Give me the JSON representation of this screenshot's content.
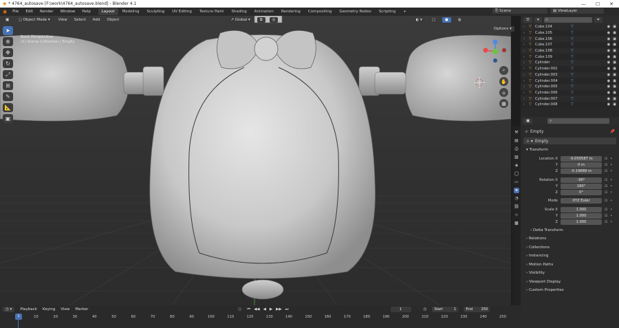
{
  "window": {
    "title": "* 4764_autosave [F:\\work\\4764_autosave.blend] - Blender 4.1",
    "controls": [
      "—",
      "☐",
      "✕"
    ]
  },
  "menus": [
    "File",
    "Edit",
    "Render",
    "Window",
    "Help"
  ],
  "workspaces": [
    {
      "label": "Layout",
      "active": true
    },
    {
      "label": "Modeling"
    },
    {
      "label": "Sculpting"
    },
    {
      "label": "UV Editing"
    },
    {
      "label": "Texture Paint"
    },
    {
      "label": "Shading"
    },
    {
      "label": "Animation"
    },
    {
      "label": "Rendering"
    },
    {
      "label": "Compositing"
    },
    {
      "label": "Geometry Nodes"
    },
    {
      "label": "Scripting"
    },
    {
      "label": "+"
    }
  ],
  "scene": {
    "label": "Scene",
    "viewlayer": "ViewLayer"
  },
  "viewport": {
    "mode": "Object Mode",
    "menus": [
      "View",
      "Select",
      "Add",
      "Object"
    ],
    "orientation": "Global",
    "options_label": "Options",
    "info_line1": "Back Perspective",
    "info_line2": "(1) Scene Collection | Empty"
  },
  "outliner": {
    "search_placeholder": "",
    "items": [
      "Cube.104",
      "Cube.105",
      "Cube.106",
      "Cube.107",
      "Cube.108",
      "Cube.109",
      "Cylinder",
      "Cylinder.002",
      "Cylinder.003",
      "Cylinder.004",
      "Cylinder.005",
      "Cylinder.006",
      "Cylinder.007",
      "Cylinder.008"
    ]
  },
  "properties": {
    "object_name": "Empty",
    "data_name": "Empty",
    "transform_label": "Transform",
    "location": {
      "label": "Location X",
      "x": "-0.050587 m",
      "y": "0 m",
      "z": "-0.19689 m"
    },
    "rotation": {
      "label": "Rotation X",
      "x": "-90°",
      "y": "180°",
      "z": "0°"
    },
    "mode": {
      "label": "Mode",
      "value": "XYZ Euler"
    },
    "scale": {
      "label": "Scale X",
      "x": "1.000",
      "y": "1.000",
      "z": "1.000"
    },
    "axis_y": "Y",
    "axis_z": "Z",
    "delta": "Delta Transform",
    "sections": [
      "Relations",
      "Collections",
      "Instancing",
      "Motion Paths",
      "Visibility",
      "Viewport Display",
      "Custom Properties"
    ]
  },
  "timeline": {
    "menus": [
      "Playback",
      "Keying",
      "View",
      "Marker"
    ],
    "current_frame": "1",
    "start_label": "Start",
    "start_value": "1",
    "end_label": "End",
    "end_value": "250",
    "playhead": "1",
    "ticks": [
      "10",
      "20",
      "30",
      "40",
      "50",
      "60",
      "70",
      "80",
      "90",
      "100",
      "110",
      "120",
      "130",
      "140",
      "150",
      "160",
      "170",
      "180",
      "190",
      "200",
      "210",
      "220",
      "230",
      "240",
      "250"
    ]
  },
  "colors": {
    "accent": "#4772b3",
    "axis_x": "#e64b4b",
    "axis_y": "#6fc43f",
    "axis_z": "#4b8ae6"
  }
}
